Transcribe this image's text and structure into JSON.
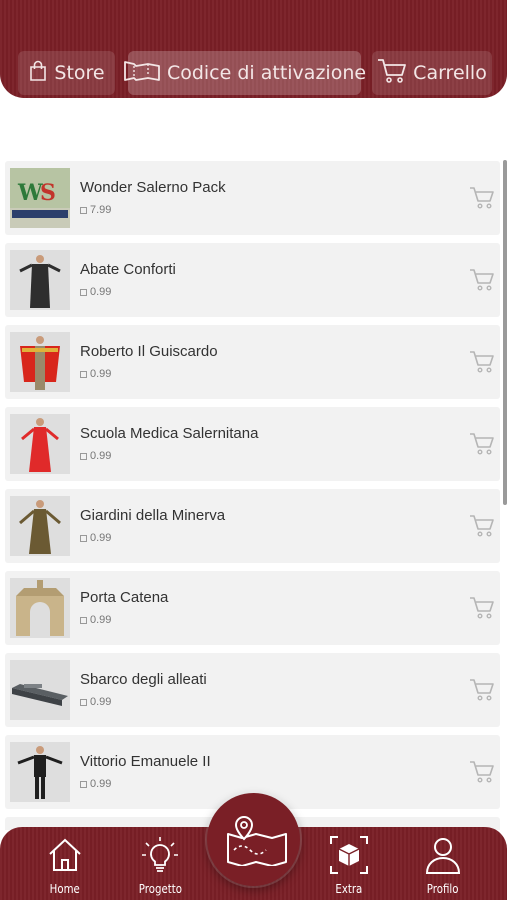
{
  "header": {
    "store_label": "Store",
    "code_label": "Codice di attivazione",
    "cart_label": "Carrello"
  },
  "items": [
    {
      "name": "Wonder Salerno Pack",
      "price": "7.99",
      "thumb": "logo"
    },
    {
      "name": "Abate Conforti",
      "price": "0.99",
      "thumb": "figure-black"
    },
    {
      "name": "Roberto Il Guiscardo",
      "price": "0.99",
      "thumb": "figure-red-cape"
    },
    {
      "name": "Scuola Medica Salernitana",
      "price": "0.99",
      "thumb": "figure-red-dress"
    },
    {
      "name": "Giardini della Minerva",
      "price": "0.99",
      "thumb": "figure-olive"
    },
    {
      "name": "Porta Catena",
      "price": "0.99",
      "thumb": "arch"
    },
    {
      "name": "Sbarco degli alleati",
      "price": "0.99",
      "thumb": "boat"
    },
    {
      "name": "Vittorio Emanuele II",
      "price": "0.99",
      "thumb": "figure-dark"
    }
  ],
  "nav": {
    "home": "Home",
    "progetto": "Progetto",
    "extra": "Extra",
    "profilo": "Profilo"
  },
  "colors": {
    "brand": "#7a1f26",
    "row_bg": "#f2f2f2"
  },
  "icons": {
    "store": "shopping-bag-icon",
    "code": "ticket-icon",
    "cart": "cart-icon",
    "home": "house-icon",
    "progetto": "lightbulb-icon",
    "map": "map-pin-icon",
    "extra": "ar-cube-icon",
    "profilo": "user-icon"
  }
}
